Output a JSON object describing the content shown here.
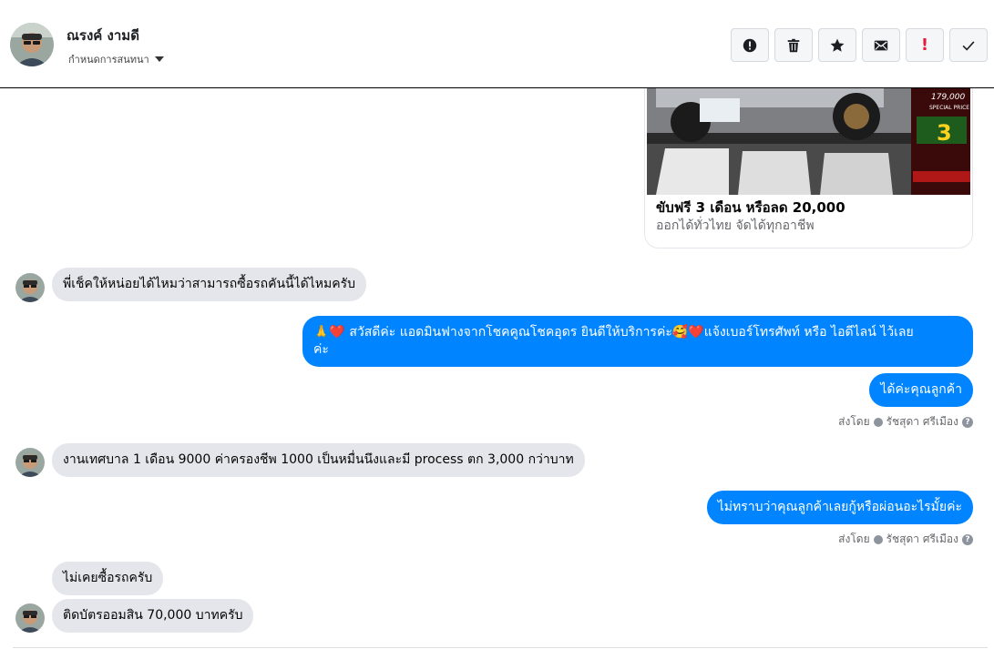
{
  "header": {
    "contact_name": "ณรงค์ งามดี",
    "assign_label": "กำหนดการสนทนา",
    "toolbar": [
      {
        "name": "report-spam-button",
        "icon": "alert-circle-icon"
      },
      {
        "name": "delete-button",
        "icon": "trash-icon"
      },
      {
        "name": "star-button",
        "icon": "star-icon"
      },
      {
        "name": "mark-unread-button",
        "icon": "envelope-icon"
      },
      {
        "name": "follow-up-button",
        "icon": "exclamation-icon",
        "glyph": "!"
      },
      {
        "name": "mark-done-button",
        "icon": "check-icon"
      }
    ]
  },
  "post_card": {
    "title": "ขับฟรี 3 เดือน หรือลด 20,000",
    "subtitle": "ออกได้ทั่วไทย จัดได้ทุกอาชีพ",
    "image_price": "179,000",
    "image_tag": "SPECIAL PRICE",
    "image_big_number": "3"
  },
  "messages": [
    {
      "dir": "in",
      "text": "พี่เช็คให้หน่อยได้ไหมว่าสามารถซื้อรถคันนี้ได้ไหมครับ"
    },
    {
      "dir": "out",
      "line1": "🙏❤️ สวัสดีค่ะ แอดมินฟางจากโชคคูณโชคอุดร ยินดีให้บริการค่ะ🥰❤️แจ้งเบอร์โทรศัพท์ หรือ ไอดีไลน์  ไว้เลย",
      "line2": "ค่ะ"
    },
    {
      "dir": "out",
      "text": "ได้ค่ะคุณลูกค้า"
    },
    {
      "dir": "in",
      "text": "งานเทศบาล 1 เดือน 9000 ค่าครองชีพ 1000 เป็นหมื่นนึงและมี process ตก 3,000 กว่าบาท"
    },
    {
      "dir": "out",
      "text": "ไม่ทราบว่าคุณลูกค้าเลยกู้หรือผ่อนอะไรมั้ยค่ะ"
    },
    {
      "dir": "in",
      "text": "ไม่เคยซื้อรถครับ"
    },
    {
      "dir": "in",
      "text": "ติดบัตรออมสิน 70,000 บาทครับ"
    }
  ],
  "sent_by": {
    "prefix": "ส่งโดย",
    "agent": "รัชสุดา ศรีเมือง",
    "help_glyph": "?"
  },
  "colors": {
    "outgoing_bubble": "#0084ff",
    "incoming_bubble": "#e4e6eb",
    "follow_up_red": "#e41e3f"
  }
}
